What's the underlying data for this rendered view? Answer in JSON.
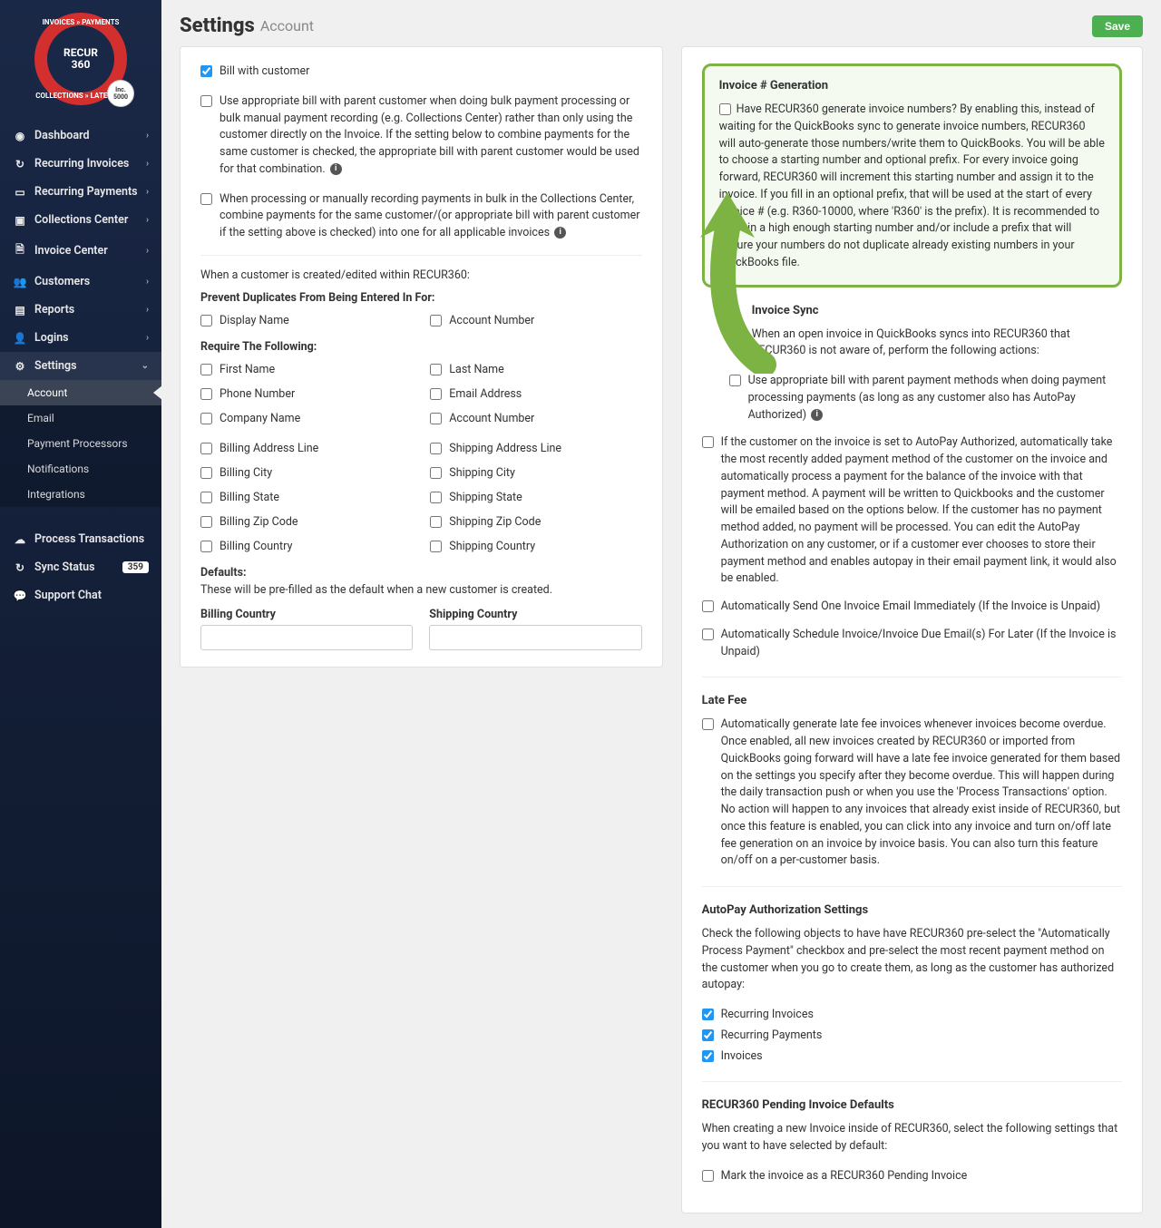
{
  "brand": {
    "name": "RECUR",
    "sub": "360",
    "ring_top": "INVOICES  »  PAYMENTS",
    "ring_bottom": "COLLECTIONS  »  LATE  FEES",
    "badge": "Inc. 5000"
  },
  "save_label": "Save",
  "page": {
    "title": "Settings",
    "subtitle": "Account"
  },
  "nav": {
    "items": [
      {
        "label": "Dashboard"
      },
      {
        "label": "Recurring Invoices"
      },
      {
        "label": "Recurring Payments"
      },
      {
        "label": "Collections Center"
      },
      {
        "label": "Invoice Center"
      },
      {
        "label": "Customers"
      },
      {
        "label": "Reports"
      },
      {
        "label": "Logins"
      },
      {
        "label": "Settings"
      }
    ],
    "settings_sub": [
      {
        "label": "Account"
      },
      {
        "label": "Email"
      },
      {
        "label": "Payment Processors"
      },
      {
        "label": "Notifications"
      },
      {
        "label": "Integrations"
      }
    ],
    "bottom": [
      {
        "label": "Process Transactions"
      },
      {
        "label": "Sync Status",
        "badge": "359"
      },
      {
        "label": "Support Chat"
      }
    ]
  },
  "left": {
    "bill_with_customer": "Bill with customer",
    "use_appropriate": "Use appropriate bill with parent customer when doing bulk payment processing or bulk manual payment recording (e.g. Collections Center) rather than only using the customer directly on the Invoice. If the setting below to combine payments for the same customer is checked, the appropriate bill with parent customer would be used for that combination.",
    "when_processing": "When processing or manually recording payments in bulk in the Collections Center, combine payments for the same customer/(or appropriate bill with parent customer if the setting above is checked) into one for all applicable invoices",
    "when_created": "When a customer is created/edited within RECUR360:",
    "prevent_dup_head": "Prevent Duplicates From Being Entered In For:",
    "dup": {
      "display_name": "Display Name",
      "account_number": "Account Number"
    },
    "require_head": "Require The Following:",
    "req": {
      "first_name": "First Name",
      "last_name": "Last Name",
      "phone": "Phone Number",
      "email": "Email Address",
      "company": "Company Name",
      "account_number": "Account Number",
      "billing_addr": "Billing Address Line",
      "shipping_addr": "Shipping Address Line",
      "billing_city": "Billing City",
      "shipping_city": "Shipping City",
      "billing_state": "Billing State",
      "shipping_state": "Shipping State",
      "billing_zip": "Billing Zip Code",
      "shipping_zip": "Shipping Zip Code",
      "billing_country": "Billing Country",
      "shipping_country": "Shipping Country"
    },
    "defaults_head": "Defaults:",
    "defaults_sub": "These will be pre-filled as the default when a new customer is created.",
    "billing_country_label": "Billing Country",
    "shipping_country_label": "Shipping Country"
  },
  "right": {
    "invoice_gen_head": "Invoice # Generation",
    "invoice_gen_body": "Have RECUR360 generate invoice numbers? By enabling this, instead of waiting for the QuickBooks sync to generate invoice numbers, RECUR360 will auto-generate those numbers/write them to QuickBooks. You will be able to choose a starting number and optional prefix. For every invoice going forward, RECUR360 will increment this starting number and assign it to the invoice. If you fill in an optional prefix, that will be used at the start of every invoice # (e.g. R360-10000, where 'R360' is the prefix). It is recommended to enter in a high enough starting number and/or include a prefix that will ensure your numbers do not duplicate already existing numbers in your QuickBooks file.",
    "invoice_sync_head": "Invoice Sync",
    "invoice_sync_body": "When an open invoice in QuickBooks syncs into RECUR360 that RECUR360 is not aware of, perform the following actions:",
    "use_appropriate_pay": "Use appropriate bill with parent payment methods when doing payment processing payments (as long as any customer also has AutoPay Authorized)",
    "autopay_auto": "If the customer on the invoice is set to AutoPay Authorized, automatically take the most recently added payment method of the customer on the invoice and automatically process a payment for the balance of the invoice with that payment method. A payment will be written to Quickbooks and the customer will be emailed based on the options below. If the customer has no payment method added, no payment will be processed. You can edit the AutoPay Authorization on any customer, or if a customer ever chooses to store their payment method and enables autopay in their email payment link, it would also be enabled.",
    "auto_send": "Automatically Send One Invoice Email Immediately (If the Invoice is Unpaid)",
    "auto_schedule": "Automatically Schedule Invoice/Invoice Due Email(s) For Later (If the Invoice is Unpaid)",
    "latefee_head": "Late Fee",
    "latefee_body": "Automatically generate late fee invoices whenever invoices become overdue. Once enabled, all new invoices created by RECUR360 or imported from QuickBooks going forward will have a late fee invoice generated for them based on the settings you specify after they become overdue. This will happen during the daily transaction push or when you use the 'Process Transactions' option. No action will happen to any invoices that already exist inside of RECUR360, but once this feature is enabled, you can click into any invoice and turn on/off late fee generation on an invoice by invoice basis. You can also turn this feature on/off on a per-customer basis.",
    "autopay_head": "AutoPay Authorization Settings",
    "autopay_body": "Check the following objects to have have RECUR360 pre-select the \"Automatically Process Payment\" checkbox and pre-select the most recent payment method on the customer when you go to create them, as long as the customer has authorized autopay:",
    "autopay_opts": {
      "ri": "Recurring Invoices",
      "rp": "Recurring Payments",
      "inv": "Invoices"
    },
    "pending_head": "RECUR360 Pending Invoice Defaults",
    "pending_body": "When creating a new Invoice inside of RECUR360, select the following settings that you want to have selected by default:",
    "pending_mark": "Mark the invoice as a RECUR360 Pending Invoice"
  }
}
